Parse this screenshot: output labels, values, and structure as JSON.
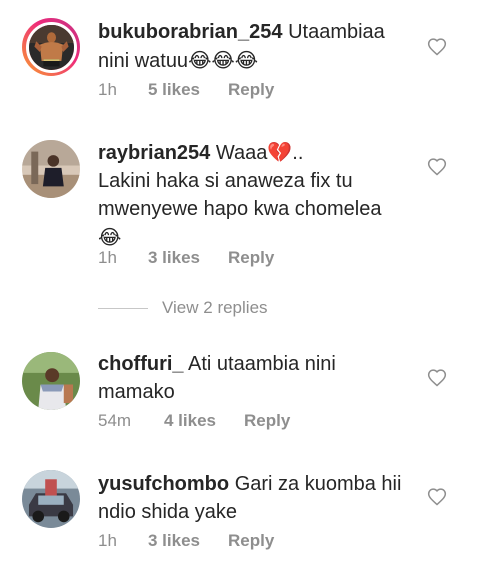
{
  "comments": [
    {
      "username": "bukuborabrian_254",
      "text": "Utaambiaa nini watuu",
      "emoji": "😂😂😂",
      "time": "1h",
      "likes": "5 likes",
      "reply": "Reply",
      "avatar_icon": "boxer-avatar",
      "has_story_ring": true
    },
    {
      "username": "raybrian254",
      "text": "Waaa",
      "emoji": "💔",
      "text_after_emoji": "..",
      "text_line2": "Lakini haka si anaweza fix tu mwenyewe hapo kwa chomelea",
      "emoji2": "😂",
      "time": "1h",
      "likes": "3 likes",
      "reply": "Reply",
      "avatar_icon": "person-avatar"
    },
    {
      "username": "choffuri_",
      "text": "Ati utaambia nini mamako",
      "time": "54m",
      "likes": "4 likes",
      "reply": "Reply",
      "avatar_icon": "person-avatar"
    },
    {
      "username": "yusufchombo",
      "text": "Gari za kuomba hii ndio shida yake",
      "time": "1h",
      "likes": "3 likes",
      "reply": "Reply",
      "avatar_icon": "car-avatar"
    }
  ],
  "view_replies": "View 2 replies",
  "colors": {
    "text": "#262626",
    "meta": "#8e8e8e",
    "story_ring_start": "#f9a02f",
    "story_ring_end": "#c13584"
  }
}
